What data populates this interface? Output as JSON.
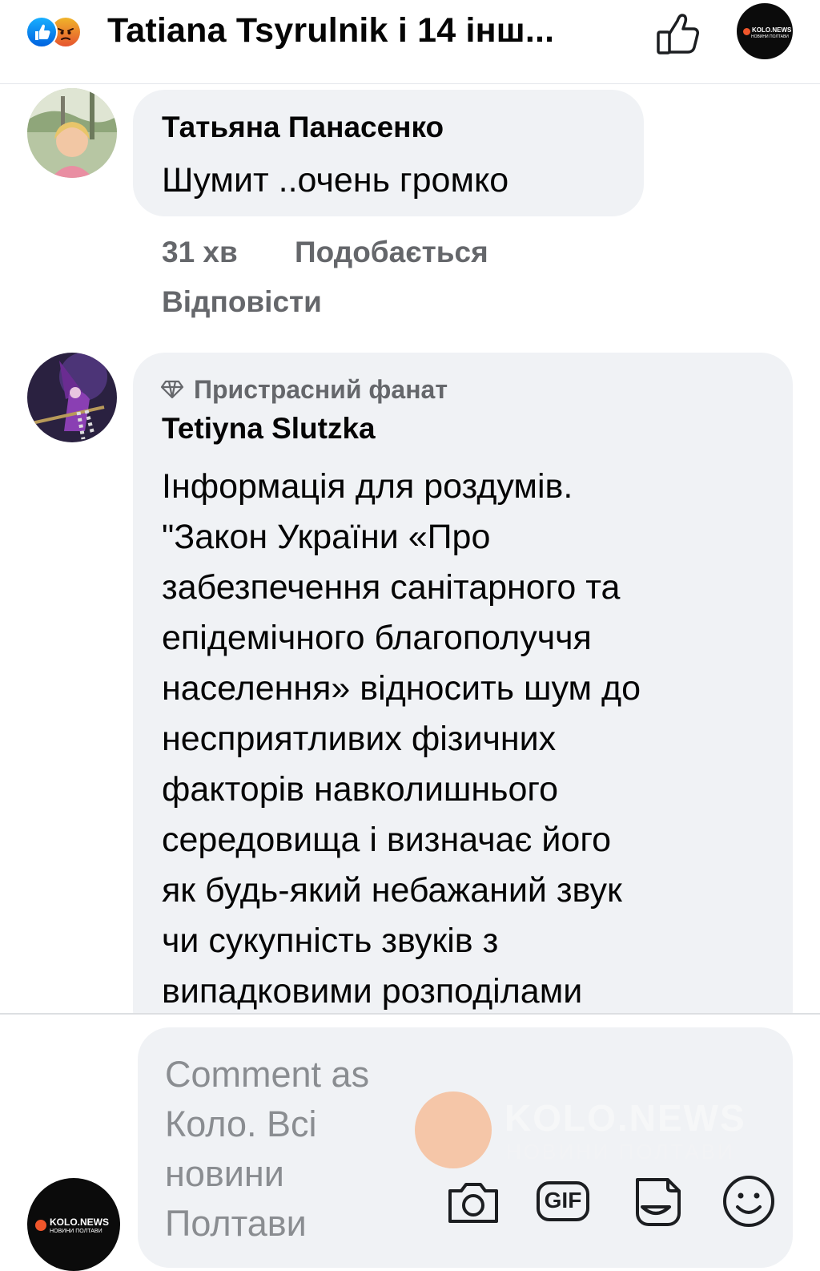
{
  "header": {
    "reactors_title": "Tatiana  Tsyrulnik і 14 інш...",
    "reaction_icons": [
      "like-icon",
      "angry-icon"
    ],
    "like_button_icon": "thumbs-up-outline-icon",
    "page_logo": {
      "name": "KOLO.NEWS",
      "tagline": "НОВИНИ ПОЛТАВИ"
    }
  },
  "comments": [
    {
      "author": "Татьяна Панасенко",
      "text": "Шумит ..очень громко",
      "time": "31 хв",
      "like_label": "Подобається",
      "reply_label": "Відповісти"
    },
    {
      "badge_icon": "diamond-icon",
      "badge": "Пристрасний фанат",
      "author": "Tetiyna Slutzka",
      "lines": [
        "Інформація для роздумів.",
        "\"Закон України «Про",
        "забезпечення санітарного та",
        "епідемічного благополуччя",
        "населення» відносить шум до",
        "несприятливих фізичних",
        "факторів навколишнього",
        "середовища і визначає його",
        "як будь-який небажаний звук",
        "чи сукупність звуків з",
        "випадковими розподілами"
      ]
    }
  ],
  "composer": {
    "placeholder_lines": [
      "Comment as",
      "Коло. Всі",
      "новини",
      "Полтави"
    ],
    "watermark": {
      "name": "KOLO.NEWS",
      "tagline": "НОВИНИ ПОЛТАВИ"
    },
    "tool_icons": [
      "camera-icon",
      "gif-icon",
      "sticker-icon",
      "emoji-icon"
    ],
    "tool_labels": {
      "gif": "GIF"
    }
  },
  "colors": {
    "bubble": "#f0f2f5",
    "secondary_text": "#65676b",
    "placeholder": "#8a8d91",
    "like_blue": "#1877f2",
    "angry_orange": "#e6542f",
    "brand_orange": "#f0562b"
  }
}
